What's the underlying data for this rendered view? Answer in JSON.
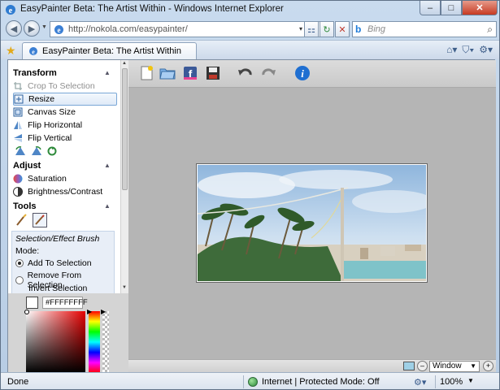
{
  "window": {
    "title": "EasyPainter Beta: The Artist Within - Windows Internet Explorer",
    "minimize": "–",
    "maximize": "□",
    "close": "✕"
  },
  "address_bar": {
    "url": "http://nokola.com/easypainter/",
    "drop": "▾",
    "compat": "⚏",
    "refresh": "↻",
    "stop": "✕"
  },
  "search": {
    "engine_glyph": "b",
    "placeholder": "Bing",
    "go": "⌕"
  },
  "tab": {
    "label": "EasyPainter Beta: The Artist Within"
  },
  "tab_tools": [
    "⌂▾",
    "⛉▾",
    "⚙▾"
  ],
  "left_panel": {
    "transform": {
      "heading": "Transform",
      "items": [
        {
          "label": "Crop To Selection",
          "icon": "crop-icon",
          "state": "disabled"
        },
        {
          "label": "Resize",
          "icon": "resize-icon",
          "state": "selected"
        },
        {
          "label": "Canvas Size",
          "icon": "canvas-size-icon",
          "state": "normal"
        },
        {
          "label": "Flip Horizontal",
          "icon": "flip-horizontal-icon",
          "state": "normal"
        },
        {
          "label": "Flip Vertical",
          "icon": "flip-vertical-icon",
          "state": "normal"
        }
      ]
    },
    "adjust": {
      "heading": "Adjust",
      "items": [
        {
          "label": "Saturation",
          "icon": "saturation-icon"
        },
        {
          "label": "Brightness/Contrast",
          "icon": "brightness-contrast-icon"
        }
      ]
    },
    "tools": {
      "heading": "Tools"
    },
    "brush": {
      "title": "Selection/Effect Brush",
      "mode_label": "Mode:",
      "options": [
        {
          "label": "Add To Selection",
          "checked": true
        },
        {
          "label": "Remove From Selection",
          "checked": false
        },
        {
          "label": "Invert Selection",
          "checked": false
        }
      ]
    }
  },
  "color_picker": {
    "hex": "#FFFFFFFF",
    "hue_color": "#e60000"
  },
  "toolbar": {
    "icons": [
      "new-image-icon",
      "open-folder-icon",
      "facebook-icon",
      "save-icon",
      "undo-icon",
      "redo-icon",
      "info-icon"
    ]
  },
  "canvas": {
    "image_desc": "beach"
  },
  "bottom_bar": {
    "view_mode": "Window",
    "zoom_out": "–",
    "zoom_in": "+"
  },
  "status": {
    "left": "Done",
    "zone": "Internet | Protected Mode: Off",
    "zoom": "100%"
  }
}
